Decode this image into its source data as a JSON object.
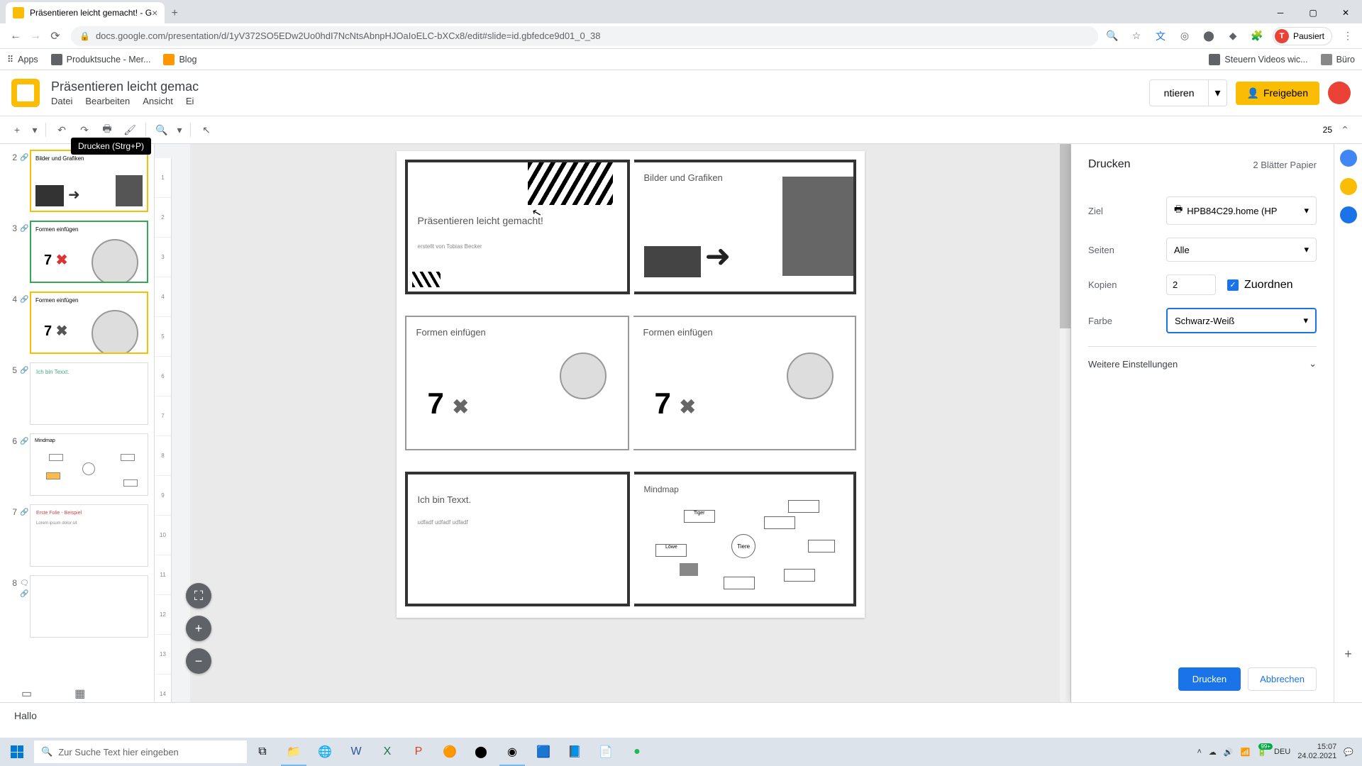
{
  "browser": {
    "tab_title": "Präsentieren leicht gemacht! - G",
    "url": "docs.google.com/presentation/d/1yV372SO5EDw2Uo0hdI7NcNtsAbnpHJOaIoELC-bXCx8/edit#slide=id.gbfedce9d01_0_38",
    "pause_label": "Pausiert",
    "avatar_letter": "T"
  },
  "bookmarks": {
    "apps": "Apps",
    "items": [
      "Produktsuche - Mer...",
      "Blog"
    ],
    "right_items": [
      "Steuern Videos wic...",
      "Büro"
    ]
  },
  "slides": {
    "logo_alt": "Google Slides",
    "doc_title": "Präsentieren leicht gemac",
    "menus": [
      "Datei",
      "Bearbeiten",
      "Ansicht",
      "Ei"
    ],
    "present_btn": "ntieren",
    "share_btn": "Freigeben",
    "tooltip": "Drucken (Strg+P)"
  },
  "toolbar": {
    "zoom_value": "25"
  },
  "thumbnails": [
    {
      "num": "2",
      "title": "Bilder und Grafiken"
    },
    {
      "num": "3",
      "title": "Formen einfügen",
      "big": "7"
    },
    {
      "num": "4",
      "title": "Formen einfügen",
      "big": "7"
    },
    {
      "num": "5",
      "title": "Ich bin Texxt."
    },
    {
      "num": "6",
      "title": "Mindmap"
    },
    {
      "num": "7",
      "title": "Erste Folie - Beispiel"
    },
    {
      "num": "8",
      "title": ""
    }
  ],
  "preview": {
    "slide1_title": "Präsentieren leicht gemacht!",
    "slide1_sub": "erstellt von Tobias Becker",
    "slide2_title": "Bilder und Grafiken",
    "slide3_title": "Formen einfügen",
    "slide3_big": "7",
    "slide4_title": "Formen einfügen",
    "slide4_big": "7",
    "slide5_title": "Ich bin Texxt.",
    "slide5_sub": "udfadf udfadf udfadf",
    "slide6_title": "Mindmap",
    "mind_center": "Tiere",
    "mind_nodes": [
      "Tiger",
      "Löwe"
    ]
  },
  "print": {
    "title": "Drucken",
    "sheets_info": "2 Blätter Papier",
    "rows": {
      "destination": {
        "label": "Ziel",
        "value": "HPB84C29.home (HP"
      },
      "pages": {
        "label": "Seiten",
        "value": "Alle"
      },
      "copies": {
        "label": "Kopien",
        "value": "2",
        "collate": "Zuordnen"
      },
      "color": {
        "label": "Farbe",
        "value": "Schwarz-Weiß"
      }
    },
    "more": "Weitere Einstellungen",
    "print_btn": "Drucken",
    "cancel_btn": "Abbrechen"
  },
  "notes": {
    "text": "Hallo"
  },
  "taskbar": {
    "search_placeholder": "Zur Suche Text hier eingeben",
    "lang": "DEU",
    "time": "15:07",
    "date": "24.02.2021",
    "badge": "99+"
  }
}
